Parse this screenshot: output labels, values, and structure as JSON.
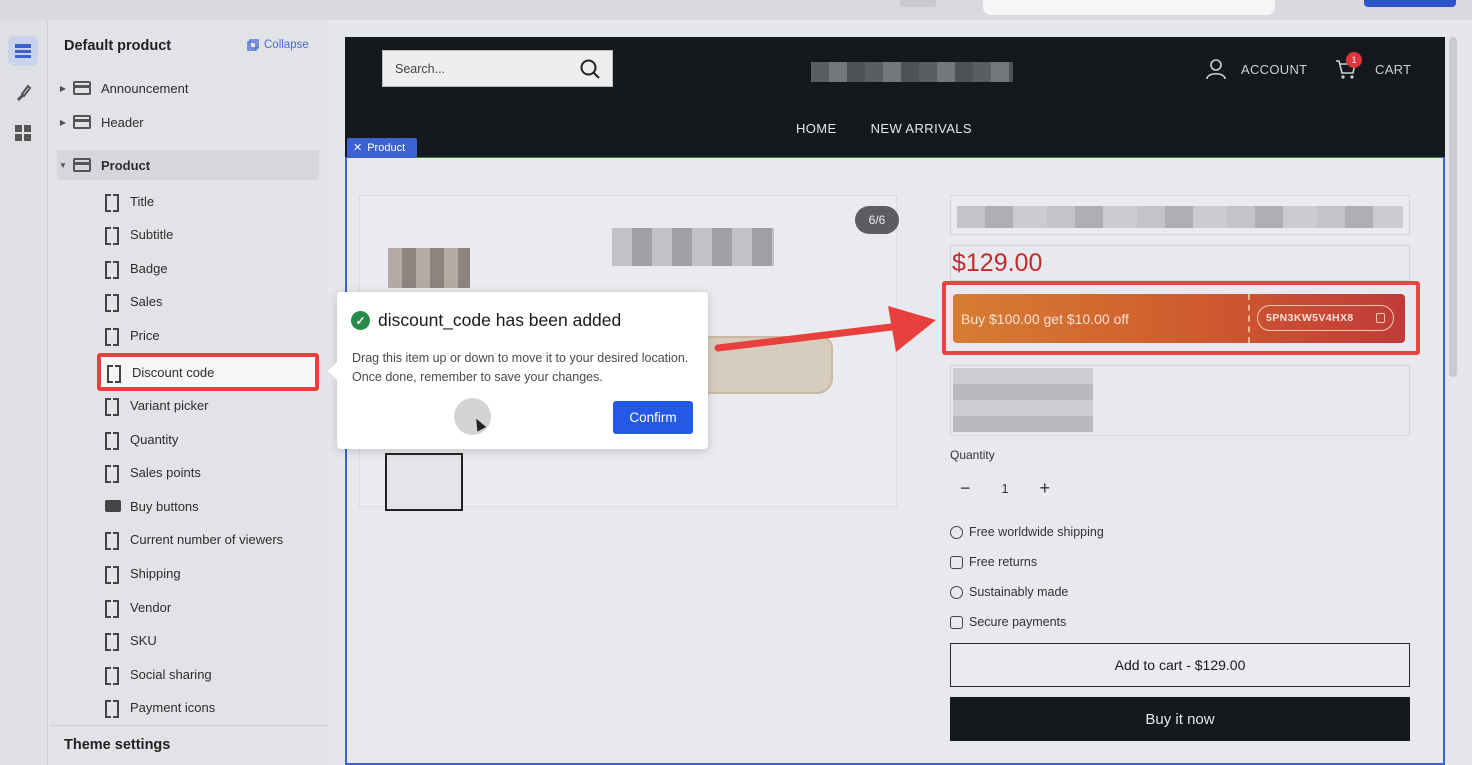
{
  "sidebar": {
    "title": "Default product",
    "collapse_label": "Collapse",
    "groups": [
      {
        "label": "Announcement"
      },
      {
        "label": "Header"
      },
      {
        "label": "Product"
      }
    ],
    "product_items": [
      {
        "label": "Title"
      },
      {
        "label": "Subtitle"
      },
      {
        "label": "Badge"
      },
      {
        "label": "Sales"
      },
      {
        "label": "Price"
      },
      {
        "label": "Discount code"
      },
      {
        "label": "Variant picker"
      },
      {
        "label": "Quantity"
      },
      {
        "label": "Sales points"
      },
      {
        "label": "Buy buttons"
      },
      {
        "label": "Current number of viewers"
      },
      {
        "label": "Shipping"
      },
      {
        "label": "Vendor"
      },
      {
        "label": "SKU"
      },
      {
        "label": "Social sharing"
      },
      {
        "label": "Payment icons"
      }
    ],
    "theme_settings": "Theme settings"
  },
  "store": {
    "search_placeholder": "Search...",
    "account_label": "ACCOUNT",
    "cart_label": "CART",
    "cart_count": "1",
    "nav": [
      "HOME",
      "NEW ARRIVALS"
    ],
    "section_tag": "Product",
    "image_counter": "6/6",
    "price": "$129.00",
    "discount_text": "Buy $100.00 get $10.00 off",
    "discount_code": "5PN3KW5V4HX8",
    "quantity_label": "Quantity",
    "quantity_value": "1",
    "perks": [
      "Free worldwide shipping",
      "Free returns",
      "Sustainably made",
      "Secure payments"
    ],
    "add_to_cart": "Add to cart - $129.00",
    "buy_now": "Buy it now"
  },
  "dialog": {
    "title": "discount_code has been added",
    "body": "Drag this item up or down to move it to your desired location. Once done, remember to save your changes.",
    "confirm": "Confirm"
  },
  "colors": {
    "accent": "#2458e6",
    "highlight": "#e8403d",
    "price": "#c62b2b"
  },
  "icons": [
    "sections-icon",
    "brush-icon",
    "apps-icon",
    "copy-icon",
    "search-icon",
    "user-icon",
    "cart-icon",
    "close-icon",
    "check-icon",
    "copy-code-icon",
    "globe-icon",
    "truck-icon",
    "leaf-icon",
    "lock-icon"
  ]
}
